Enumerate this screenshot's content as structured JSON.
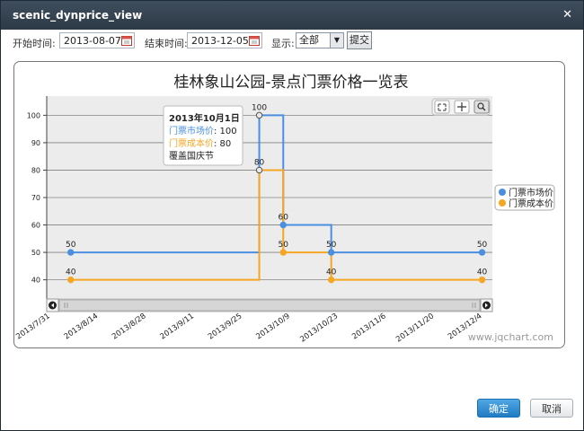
{
  "window": {
    "title": "scenic_dynprice_view"
  },
  "toolbar": {
    "start_label": "开始时间:",
    "start_value": "2013-08-07",
    "end_label": "结束时间:",
    "end_value": "2013-12-05",
    "display_label": "显示:",
    "display_value": "全部",
    "submit_label": "提交"
  },
  "buttons": {
    "ok": "确定",
    "cancel": "取消"
  },
  "chart_data": {
    "type": "line",
    "title": "桂林象山公园-景点门票价格一览表",
    "x_ticks": [
      "2013/7/31",
      "2013/8/14",
      "2013/8/28",
      "2013/9/11",
      "2013/9/25",
      "2013/10/9",
      "2013/10/23",
      "2013/11/6",
      "2013/11/20",
      "2013/12/4"
    ],
    "y_ticks": [
      40,
      50,
      60,
      70,
      80,
      90,
      100
    ],
    "ylim": [
      33,
      107
    ],
    "xlim": [
      "2013-07-31",
      "2013-12-08"
    ],
    "step": true,
    "series": [
      {
        "name": "门票市场价",
        "color": "#4a8fe0",
        "points": [
          {
            "x": "2013-08-07",
            "y": 50
          },
          {
            "x": "2013-10-01",
            "y": 100
          },
          {
            "x": "2013-10-08",
            "y": 60
          },
          {
            "x": "2013-10-22",
            "y": 50
          },
          {
            "x": "2013-12-05",
            "y": 50
          }
        ]
      },
      {
        "name": "门票成本价",
        "color": "#f5a623",
        "points": [
          {
            "x": "2013-08-07",
            "y": 40
          },
          {
            "x": "2013-10-01",
            "y": 80
          },
          {
            "x": "2013-10-08",
            "y": 50
          },
          {
            "x": "2013-10-22",
            "y": 40
          },
          {
            "x": "2013-12-05",
            "y": 40
          }
        ]
      }
    ],
    "legend_position": "right",
    "grid": true,
    "tooltip": {
      "title": "2013年10月1日",
      "line1_label": "门票市场价",
      "line1_value": ": 100",
      "line2_label": "门票成本价",
      "line2_value": ": 80",
      "note": "覆盖国庆节"
    },
    "watermark": "www.jqchart.com"
  }
}
